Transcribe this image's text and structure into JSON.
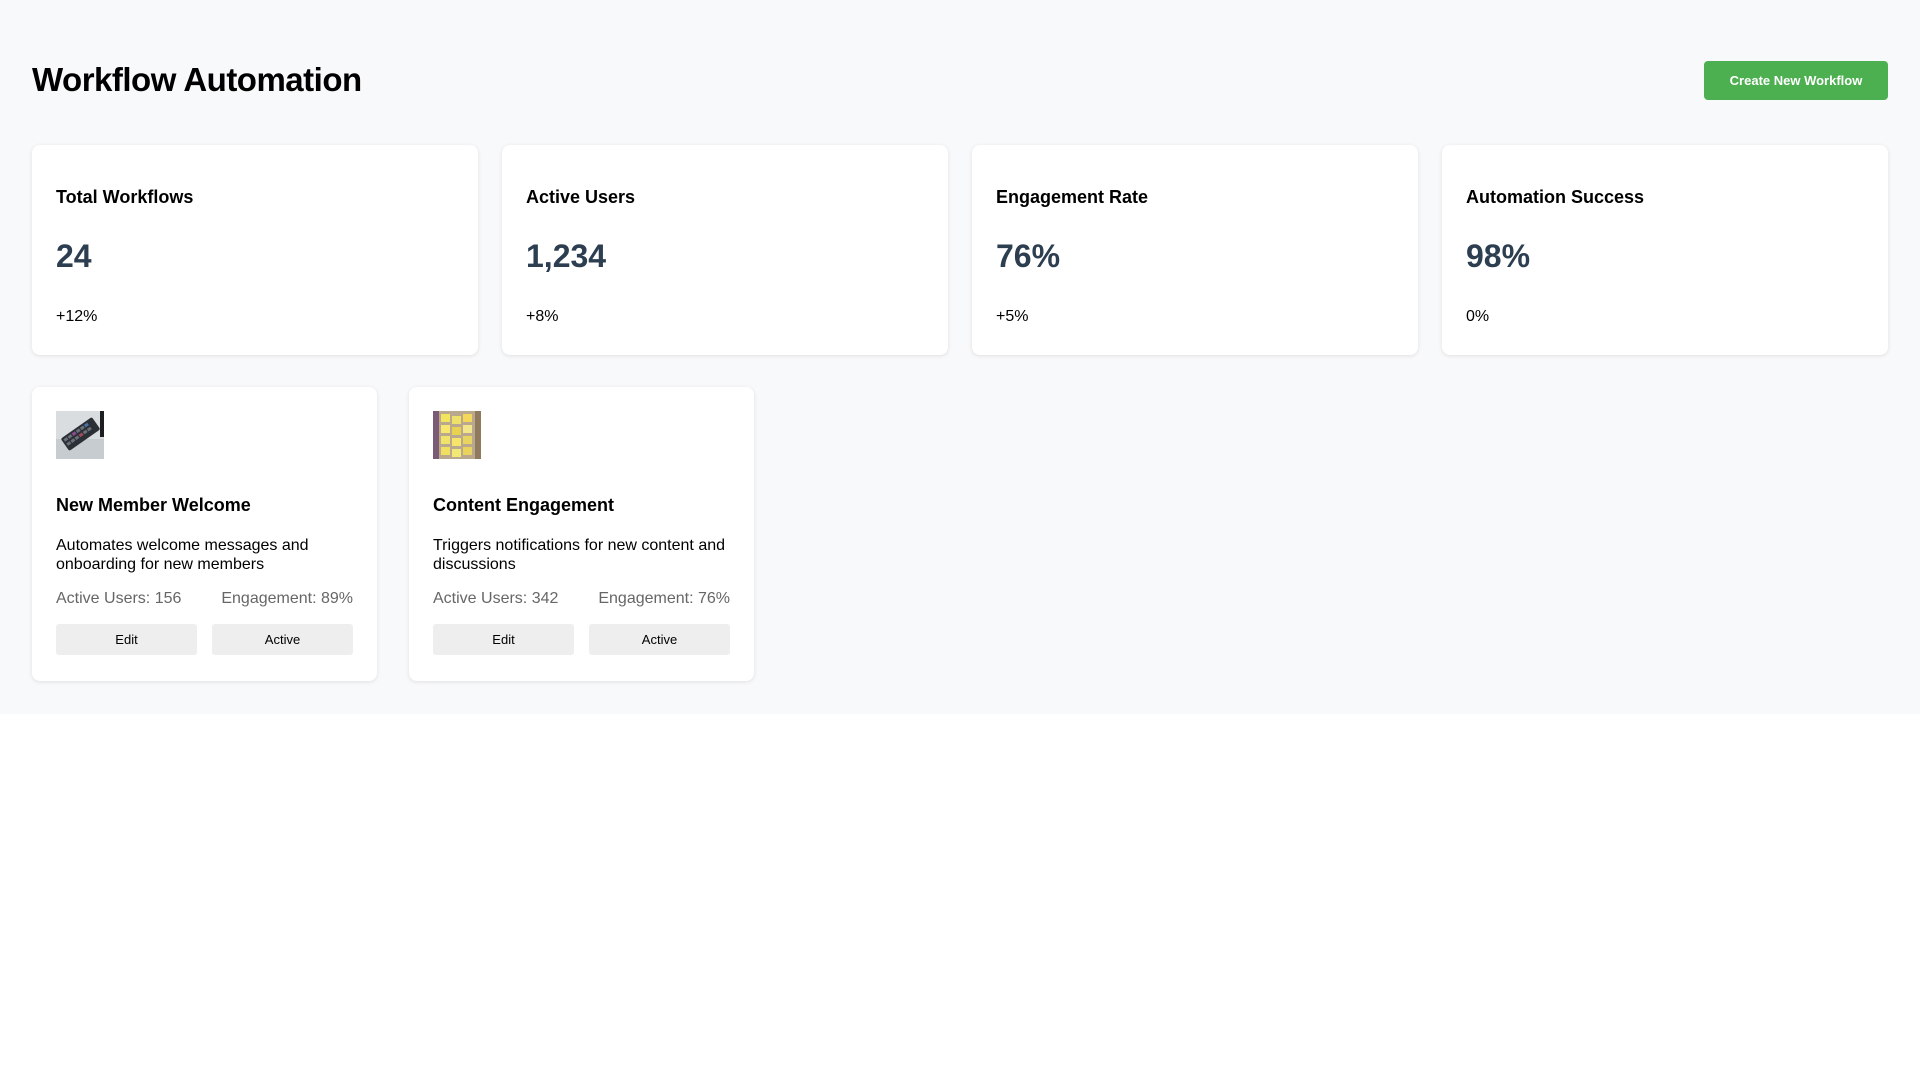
{
  "header": {
    "title": "Workflow Automation",
    "create_button_label": "Create New Workflow"
  },
  "colors": {
    "accent_green": "#4caf50",
    "stat_value": "#2c3e50",
    "page_background": "#f8f9fa"
  },
  "stats": [
    {
      "title": "Total Workflows",
      "value": "24",
      "change": "+12%"
    },
    {
      "title": "Active Users",
      "value": "1,234",
      "change": "+8%"
    },
    {
      "title": "Engagement Rate",
      "value": "76%",
      "change": "+5%"
    },
    {
      "title": "Automation Success",
      "value": "98%",
      "change": "0%"
    }
  ],
  "workflows": [
    {
      "thumbnail": "keyboard-photo",
      "title": "New Member Welcome",
      "description": "Automates welcome messages and onboarding for new members",
      "active_users": "Active Users: 156",
      "engagement": "Engagement: 89%",
      "edit_label": "Edit",
      "status_label": "Active"
    },
    {
      "thumbnail": "sticky-notes-photo",
      "title": "Content Engagement",
      "description": "Triggers notifications for new content and discussions",
      "active_users": "Active Users: 342",
      "engagement": "Engagement: 76%",
      "edit_label": "Edit",
      "status_label": "Active"
    }
  ]
}
